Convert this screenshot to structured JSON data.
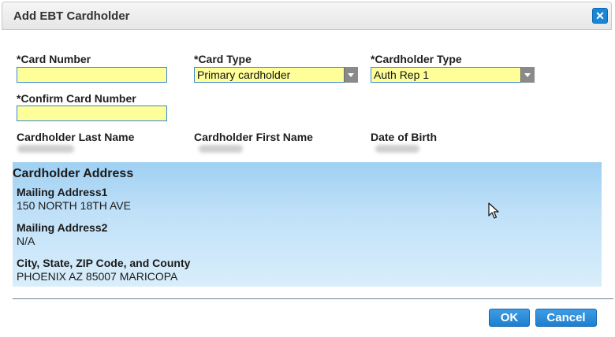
{
  "dialog": {
    "title": "Add EBT Cardholder"
  },
  "form": {
    "card_number_label": "*Card Number",
    "card_number_value": "",
    "card_type_label": "*Card Type",
    "card_type_value": "Primary cardholder",
    "cardholder_type_label": "*Cardholder Type",
    "cardholder_type_value": "Auth Rep 1",
    "confirm_card_number_label": "*Confirm Card Number",
    "confirm_card_number_value": "",
    "last_name_label": "Cardholder Last Name",
    "first_name_label": "Cardholder First Name",
    "dob_label": "Date of Birth"
  },
  "address": {
    "section_title": "Cardholder Address",
    "mailing1_label": "Mailing Address1",
    "mailing1_value": "150 NORTH 18TH AVE",
    "mailing2_label": "Mailing Address2",
    "mailing2_value": "N/A",
    "city_label": "City, State, ZIP Code, and County",
    "city_value": "PHOENIX AZ 85007 MARICOPA"
  },
  "actions": {
    "ok_label": "OK",
    "cancel_label": "Cancel"
  },
  "icons": {
    "close": "close-icon",
    "dropdown": "chevron-down-icon",
    "cursor": "mouse-pointer-icon"
  },
  "colors": {
    "required_field_bg": "#ffff99",
    "accent": "#1a86d6",
    "address_panel": "#bfe0f8"
  }
}
